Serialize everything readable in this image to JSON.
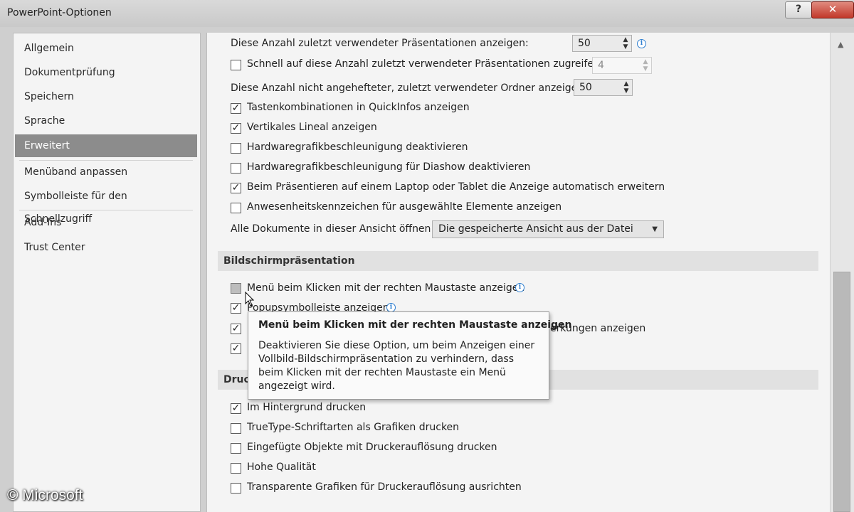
{
  "window": {
    "title": "PowerPoint-Optionen",
    "help_label": "?",
    "close_label": "✕"
  },
  "sidebar": {
    "items": [
      {
        "label": "Allgemein"
      },
      {
        "label": "Dokumentprüfung"
      },
      {
        "label": "Speichern"
      },
      {
        "label": "Sprache"
      },
      {
        "label": "Erweitert",
        "active": true
      },
      {
        "label": "Menüband anpassen"
      },
      {
        "label": "Symbolleiste für den Schnellzugriff"
      },
      {
        "label": "Add-Ins"
      },
      {
        "label": "Trust Center"
      }
    ]
  },
  "display": {
    "recent_presentations_label": "Diese Anzahl zuletzt verwendeter Präsentationen anzeigen:",
    "recent_presentations_value": "50",
    "quick_access_label": "Schnell auf diese Anzahl zuletzt verwendeter Präsentationen zugreifen:",
    "quick_access_value": "4",
    "quick_access_checked": false,
    "recent_folders_label": "Diese Anzahl nicht angehefteter, zuletzt verwendeter Ordner anzeigen:",
    "recent_folders_value": "50",
    "shortcut_tips_label": "Tastenkombinationen in QuickInfos anzeigen",
    "shortcut_tips_checked": true,
    "vertical_ruler_label": "Vertikales Lineal anzeigen",
    "vertical_ruler_checked": true,
    "hw_accel_label": "Hardwaregrafikbeschleunigung deaktivieren",
    "hw_accel_checked": false,
    "hw_accel_slideshow_label": "Hardwaregrafikbeschleunigung für Diashow deaktivieren",
    "hw_accel_slideshow_checked": false,
    "extend_display_label": "Beim Präsentieren auf einem Laptop oder Tablet die Anzeige automatisch erweitern",
    "extend_display_checked": true,
    "presence_label": "Anwesenheitskennzeichen für ausgewählte Elemente anzeigen",
    "presence_checked": false,
    "open_all_label": "Alle Dokumente in dieser Ansicht öffnen",
    "open_all_value": "Die gespeicherte Ansicht aus der Datei"
  },
  "slideshow": {
    "header": "Bildschirmpräsentation",
    "menu_right_click_label": "Menü beim Klicken mit der rechten Maustaste anzeigen",
    "menu_right_click_checked": false,
    "popup_toolbar_label": "Popupsymbolleiste anzeigen",
    "popup_toolbar_checked": true,
    "annotations_label_visible": "erkungen anzeigen",
    "annotations_checked": true,
    "end_black_checked": true
  },
  "print": {
    "header_visible": "Druc",
    "background_label": "Im Hintergrund drucken",
    "background_checked": true,
    "truetype_label": "TrueType-Schriftarten als Grafiken drucken",
    "truetype_checked": false,
    "inserted_objects_label": "Eingefügte Objekte mit Druckerauflösung drucken",
    "inserted_objects_checked": false,
    "high_quality_label": "Hohe Qualität",
    "high_quality_checked": false,
    "transparent_label": "Transparente Grafiken für Druckerauflösung ausrichten",
    "transparent_checked": false
  },
  "tooltip": {
    "title": "Menü beim Klicken mit der rechten Maustaste anzeigen",
    "body": "Deaktivieren Sie diese Option, um beim Anzeigen einer Vollbild-Bildschirmpräsentation zu verhindern, dass beim Klicken mit der rechten Maustaste ein Menü angezeigt wird."
  },
  "watermark": "© Microsoft",
  "icons": {
    "check": "✓",
    "info": "i",
    "spin_up": "▲",
    "spin_down": "▼",
    "dropdown": "▼",
    "scroll_up": "▲"
  }
}
